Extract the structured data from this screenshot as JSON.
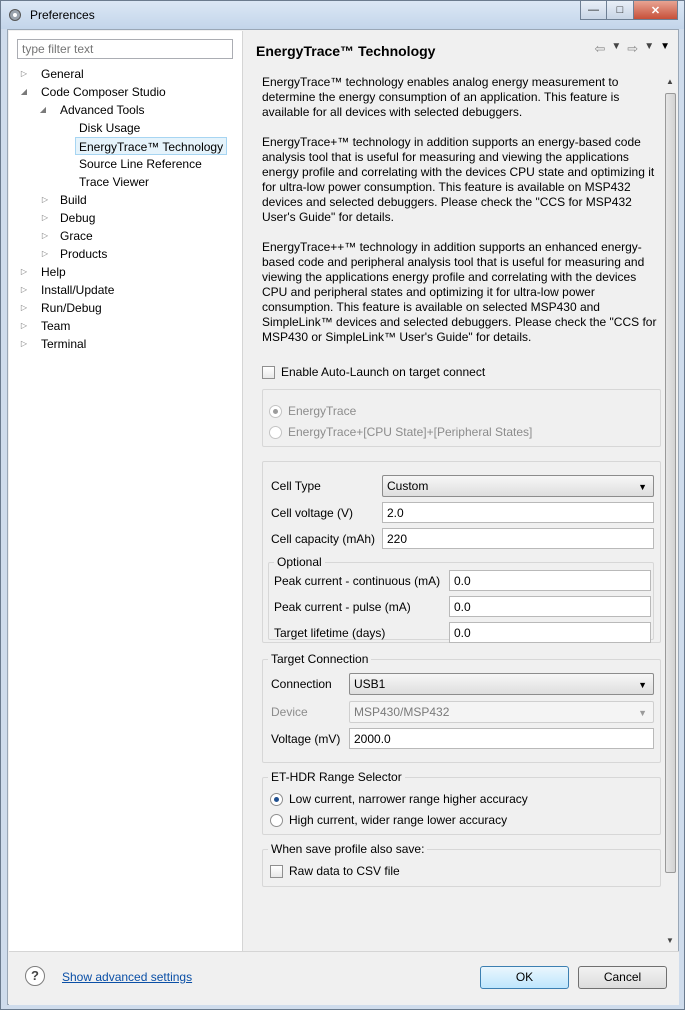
{
  "window": {
    "title": "Preferences",
    "minimize": "—",
    "maximize": "□",
    "close": "✕"
  },
  "filter": {
    "placeholder": "type filter text"
  },
  "tree": {
    "general": "General",
    "ccs": "Code Composer Studio",
    "advanced_tools": "Advanced Tools",
    "disk_usage": "Disk Usage",
    "energytrace": "EnergyTrace™ Technology",
    "source_line": "Source Line Reference",
    "trace_viewer": "Trace Viewer",
    "build": "Build",
    "debug": "Debug",
    "grace": "Grace",
    "products": "Products",
    "help": "Help",
    "install_update": "Install/Update",
    "run_debug": "Run/Debug",
    "team": "Team",
    "terminal": "Terminal"
  },
  "page": {
    "title": "EnergyTrace™ Technology",
    "para1": "EnergyTrace™ technology enables analog energy measurement to determine the energy consumption of an application. This feature is available for all devices with selected debuggers.",
    "para2": "EnergyTrace+™ technology in addition supports an energy-based code analysis tool that is useful for measuring and viewing the applications energy profile and correlating with the devices CPU state and optimizing it for ultra-low power consumption. This feature is available on MSP432 devices and selected debuggers. Please check the \"CCS for MSP432 User's Guide\" for details.",
    "para3": "EnergyTrace++™ technology in addition supports an enhanced energy-based code and peripheral analysis tool that is useful for measuring and viewing the applications energy profile and correlating with the devices CPU and peripheral states and optimizing it for ultra-low power consumption. This feature is available on selected MSP430 and SimpleLink™ devices and selected debuggers. Please check the \"CCS for MSP430 or SimpleLink™ User's Guide\" for details.",
    "auto_launch": "Enable Auto-Launch on target connect",
    "mode_et": "EnergyTrace",
    "mode_etplus": "EnergyTrace+[CPU State]+[Peripheral States]",
    "cell_type_label": "Cell Type",
    "cell_type_value": "Custom",
    "cell_voltage_label": "Cell voltage (V)",
    "cell_voltage_value": "2.0",
    "cell_capacity_label": "Cell capacity (mAh)",
    "cell_capacity_value": "220",
    "optional_label": "Optional",
    "peak_cont_label": "Peak current - continuous (mA)",
    "peak_cont_value": "0.0",
    "peak_pulse_label": "Peak current - pulse (mA)",
    "peak_pulse_value": "0.0",
    "lifetime_label": "Target lifetime (days)",
    "lifetime_value": "0.0",
    "target_conn_label": "Target Connection",
    "connection_label": "Connection",
    "connection_value": "USB1",
    "device_label": "Device",
    "device_value": "MSP430/MSP432",
    "voltage_label": "Voltage (mV)",
    "voltage_value": "2000.0",
    "hdr_label": "ET-HDR Range Selector",
    "hdr_low": "Low current, narrower range higher accuracy",
    "hdr_high": "High current, wider range lower accuracy",
    "save_label": "When save profile also save:",
    "raw_csv": "Raw data to CSV file"
  },
  "footer": {
    "advanced": "Show advanced settings",
    "ok": "OK",
    "cancel": "Cancel",
    "help": "?"
  }
}
